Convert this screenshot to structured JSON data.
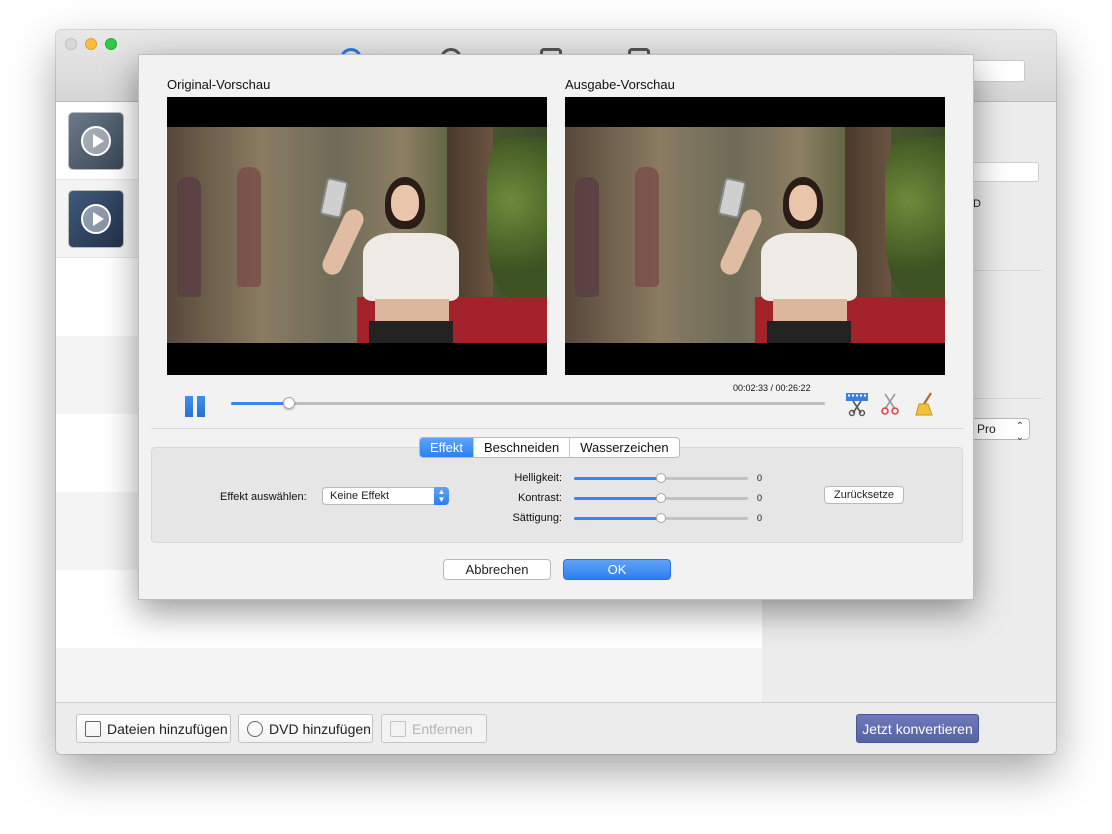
{
  "dialog": {
    "original_preview_label": "Original-Vorschau",
    "output_preview_label": "Ausgabe-Vorschau",
    "playback": {
      "time_readout": "00:02:33 / 00:26:22",
      "progress_fraction": 0.097
    },
    "tabs": [
      {
        "label": "Effekt",
        "active": true
      },
      {
        "label": "Beschneiden",
        "active": false
      },
      {
        "label": "Wasserzeichen",
        "active": false
      }
    ],
    "effect": {
      "label": "Effekt auswählen:",
      "selected": "Keine Effekt"
    },
    "sliders": [
      {
        "label": "Helligkeit:",
        "value": "0",
        "fraction": 0.5
      },
      {
        "label": "Kontrast:",
        "value": "0",
        "fraction": 0.5
      },
      {
        "label": "Sättigung:",
        "value": "0",
        "fraction": 0.5
      }
    ],
    "reset_label": "Zurücksetze",
    "cancel_label": "Abbrechen",
    "ok_label": "OK"
  },
  "right_panel": {
    "profile_select": "Pro",
    "fragment": "D"
  },
  "bottom_bar": {
    "add_files_label": "Dateien hinzufügen",
    "add_dvd_label": "DVD hinzufügen",
    "remove_label": "Entfernen",
    "convert_label": "Jetzt konvertieren"
  },
  "colors": {
    "accent": "#2c7ff0",
    "convert": "#5c69aa",
    "close_light": "#d8d8d8",
    "minimize_light": "#fdbc40",
    "maximize_light": "#34c84a"
  },
  "icons": {
    "trim": "scissors-film-icon",
    "crop": "scissors-icon",
    "clean": "broom-icon"
  }
}
